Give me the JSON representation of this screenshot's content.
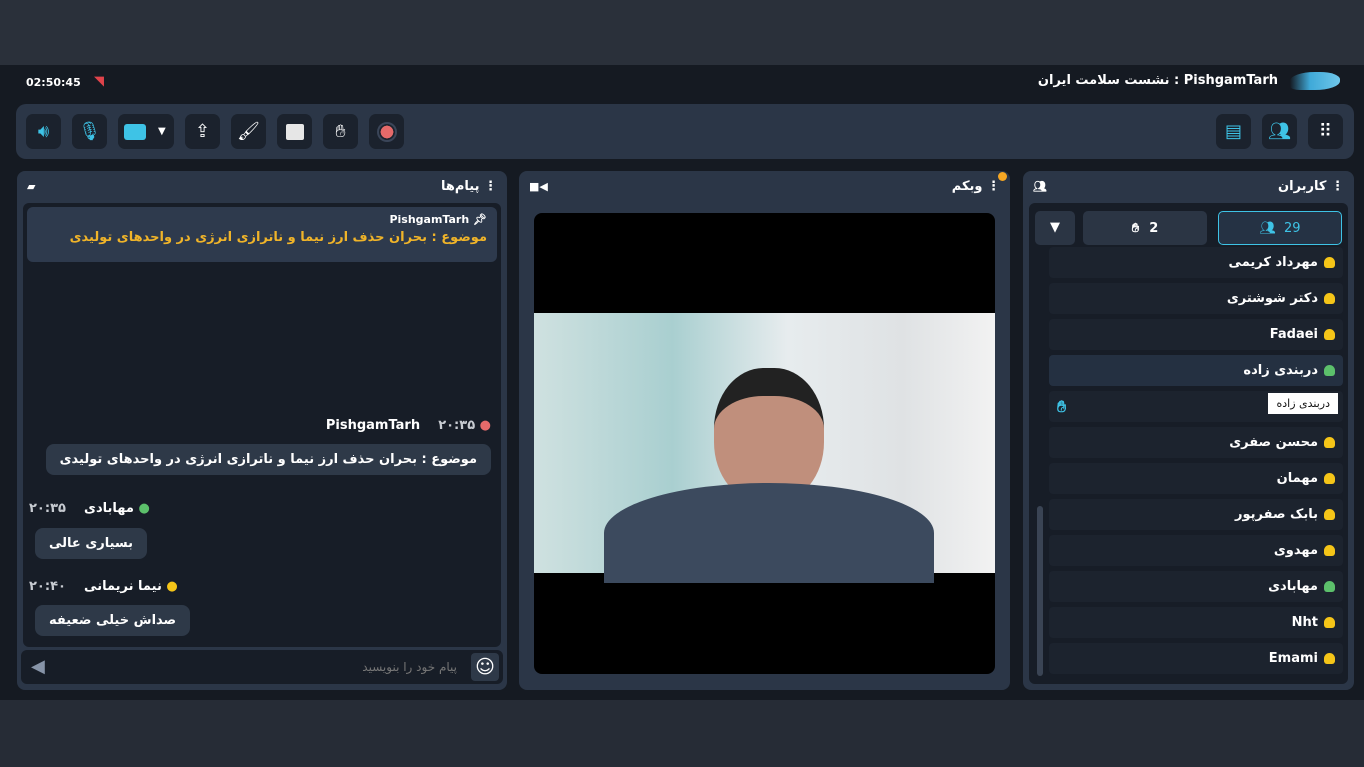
{
  "header": {
    "clock": "02:50:45",
    "title": "PishgamTarh : نشست سلامت ایران"
  },
  "toolbar": {
    "left": [
      "speaker-icon",
      "mic-icon",
      "camera-icon",
      "dropdown-icon",
      "share-screen-icon",
      "brush-icon",
      "folder-icon",
      "raise-hand-icon",
      "record-icon"
    ],
    "right": [
      "chat-icon",
      "users-icon",
      "grid-icon"
    ]
  },
  "colors": {
    "accent": "#3ec3e6",
    "panel": "#2b3647",
    "online_yellow": "#f5c518",
    "online_green": "#5cc06b",
    "host_red": "#e56a6a"
  },
  "messages_panel": {
    "title": "پیام‌ها",
    "pinned": {
      "sender": "PishgamTarh",
      "text": "موضوع : بحران حذف ارز نیما و ناترازی انرژی در واحدهای تولیدی"
    },
    "messages": [
      {
        "sender": "PishgamTarh",
        "time": "۲۰:۳۵",
        "text": "موضوع : بحران حذف ارز نیما و ناترازی انرژی در واحدهای تولیدی"
      },
      {
        "sender": "مهابادی",
        "time": "۲۰:۳۵",
        "text": "بسیاری عالی"
      },
      {
        "sender": "نیما نریمانی",
        "time": "۲۰:۴۰",
        "text": "صداش خیلی ضعیفه"
      }
    ],
    "input_placeholder": "پیام خود را بنویسید"
  },
  "webcam_panel": {
    "title": "وبکم"
  },
  "users_panel": {
    "title": "کاربران",
    "count": "29",
    "hands": "2",
    "tooltip": "دربندی زاده",
    "users": [
      {
        "name": "مهرداد کریمی",
        "status": "yellow"
      },
      {
        "name": "دکتر شوشتری",
        "status": "yellow"
      },
      {
        "name": "Fadaei",
        "status": "yellow"
      },
      {
        "name": "دربندی زاده",
        "status": "green"
      },
      {
        "name": "",
        "status": "hand"
      },
      {
        "name": "محسن صفری",
        "status": "yellow"
      },
      {
        "name": "مهمان",
        "status": "yellow"
      },
      {
        "name": "بابک صفرپور",
        "status": "yellow"
      },
      {
        "name": "مهدوی",
        "status": "yellow"
      },
      {
        "name": "مهابادی",
        "status": "green"
      },
      {
        "name": "Nht",
        "status": "yellow"
      },
      {
        "name": "Emami",
        "status": "yellow"
      }
    ]
  }
}
